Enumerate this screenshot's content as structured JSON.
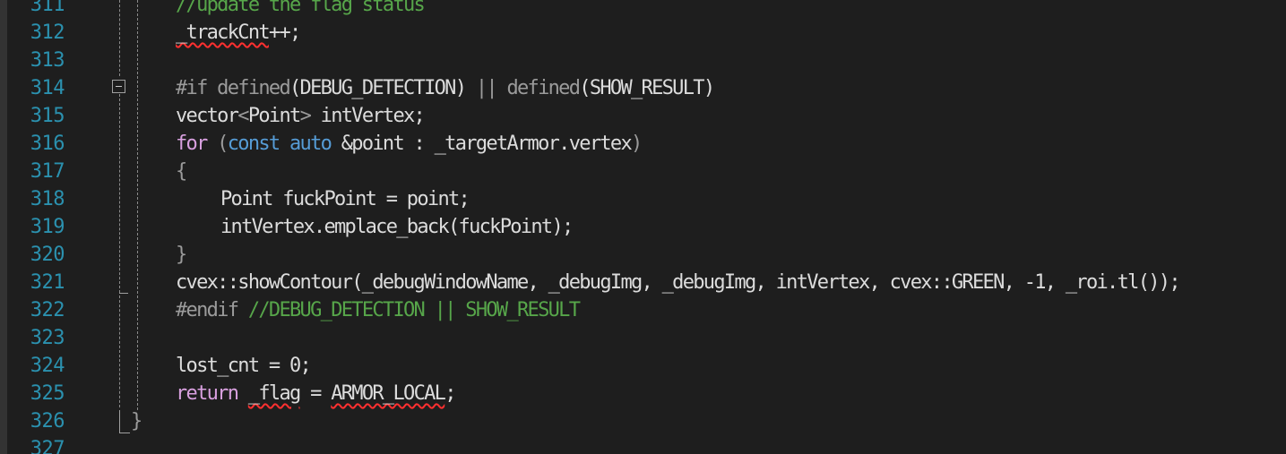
{
  "editor": {
    "lines": [
      {
        "number": "311",
        "segments": [
          {
            "t": "//update the flag status",
            "c": "cm"
          }
        ]
      },
      {
        "number": "312",
        "segments": [
          {
            "t": "_trackCnt",
            "c": "squiggle"
          },
          {
            "t": "++;",
            "c": ""
          }
        ]
      },
      {
        "number": "313",
        "segments": []
      },
      {
        "number": "314",
        "segments": [
          {
            "t": "#if defined",
            "c": "pp"
          },
          {
            "t": "(DEBUG_DETECTION)",
            "c": "mac"
          },
          {
            "t": " || defined",
            "c": "pp"
          },
          {
            "t": "(SHOW_RESULT)",
            "c": "mac"
          }
        ]
      },
      {
        "number": "315",
        "segments": [
          {
            "t": "vector",
            "c": ""
          },
          {
            "t": "<",
            "c": "pp"
          },
          {
            "t": "Point",
            "c": ""
          },
          {
            "t": ">",
            "c": "pp"
          },
          {
            "t": " intVertex;",
            "c": ""
          }
        ]
      },
      {
        "number": "316",
        "segments": [
          {
            "t": "for",
            "c": "kw2"
          },
          {
            "t": " (",
            "c": "pp"
          },
          {
            "t": "const auto",
            "c": "kw"
          },
          {
            "t": " &point : _targetArmor.vertex",
            "c": ""
          },
          {
            "t": ")",
            "c": "pp"
          }
        ]
      },
      {
        "number": "317",
        "segments": [
          {
            "t": "{",
            "c": "pp"
          }
        ]
      },
      {
        "number": "318",
        "segments": [
          {
            "t": "Point fuckPoint = point;",
            "c": ""
          }
        ],
        "indent": 2
      },
      {
        "number": "319",
        "segments": [
          {
            "t": "intVertex.emplace_back(fuckPoint);",
            "c": ""
          }
        ],
        "indent": 2
      },
      {
        "number": "320",
        "segments": [
          {
            "t": "}",
            "c": "pp"
          }
        ]
      },
      {
        "number": "321",
        "segments": [
          {
            "t": "cvex::showContour(_debugWindowName, _debugImg, _debugImg, intVertex, cvex::GREEN, -1, _roi.tl());",
            "c": ""
          }
        ]
      },
      {
        "number": "322",
        "segments": [
          {
            "t": "#endif ",
            "c": "pp"
          },
          {
            "t": "//DEBUG_DETECTION || SHOW_RESULT",
            "c": "cm"
          }
        ]
      },
      {
        "number": "323",
        "segments": []
      },
      {
        "number": "324",
        "segments": [
          {
            "t": "lost_cnt = 0;",
            "c": ""
          }
        ]
      },
      {
        "number": "325",
        "segments": [
          {
            "t": "return ",
            "c": "kw2"
          },
          {
            "t": "_flag",
            "c": "squiggle"
          },
          {
            "t": " = ",
            "c": ""
          },
          {
            "t": "ARMOR_LOCAL",
            "c": "squiggle"
          },
          {
            "t": ";",
            "c": ""
          }
        ]
      },
      {
        "number": "326",
        "segments": [
          {
            "t": "}",
            "c": "pp"
          }
        ],
        "indent": 0
      },
      {
        "number": "327",
        "segments": []
      }
    ]
  },
  "colors": {
    "background": "#1e1e1e",
    "line_number": "#2b91af",
    "comment": "#57a64a",
    "keyword": "#569cd6",
    "control_keyword": "#d8a0df",
    "default_text": "#dcdcdc"
  },
  "icons": {
    "fold": "collapse-region-icon"
  }
}
